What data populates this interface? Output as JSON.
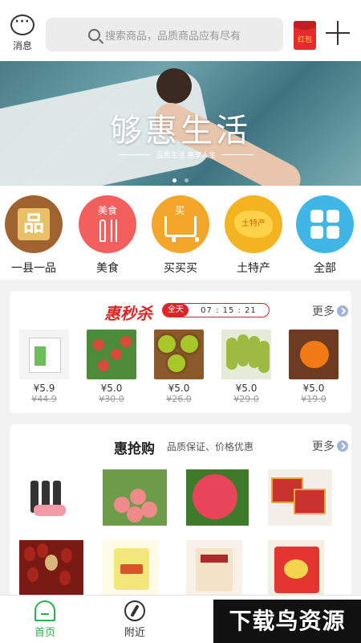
{
  "header": {
    "message_label": "消息",
    "search_placeholder": "搜索商品，品质商品应有尽有",
    "redpack_label": "红包"
  },
  "banner": {
    "title": "够惠生活",
    "subtitle": "品质生活 惠享人生"
  },
  "categories": [
    {
      "label": "一县一品",
      "icon": "product-icon",
      "icon_text": "品"
    },
    {
      "label": "美食",
      "icon": "food-icon",
      "icon_text": "美食"
    },
    {
      "label": "买买买",
      "icon": "shopping-cart-icon"
    },
    {
      "label": "土特产",
      "icon": "map-icon",
      "icon_text": "土特产"
    },
    {
      "label": "全部",
      "icon": "grid-icon"
    }
  ],
  "flash_sale": {
    "title": "惠秒杀",
    "timer_tag": "全天",
    "timer": "07 : 15 : 21",
    "more": "更多",
    "items": [
      {
        "price": "¥5.9",
        "original": "¥44.9"
      },
      {
        "price": "¥5.0",
        "original": "¥30.0"
      },
      {
        "price": "¥5.0",
        "original": "¥26.0"
      },
      {
        "price": "¥5.0",
        "original": "¥29.0"
      },
      {
        "price": "¥5.0",
        "original": "¥19.0"
      }
    ]
  },
  "group_buy": {
    "title": "惠抢购",
    "subtitle": "品质保证、价格优惠",
    "more": "更多"
  },
  "tabbar": {
    "home": "首页",
    "nearby": "附近"
  },
  "watermark": "下载鸟资源",
  "colors": {
    "accent_green": "#27b34a",
    "sale_red": "#d92525"
  }
}
